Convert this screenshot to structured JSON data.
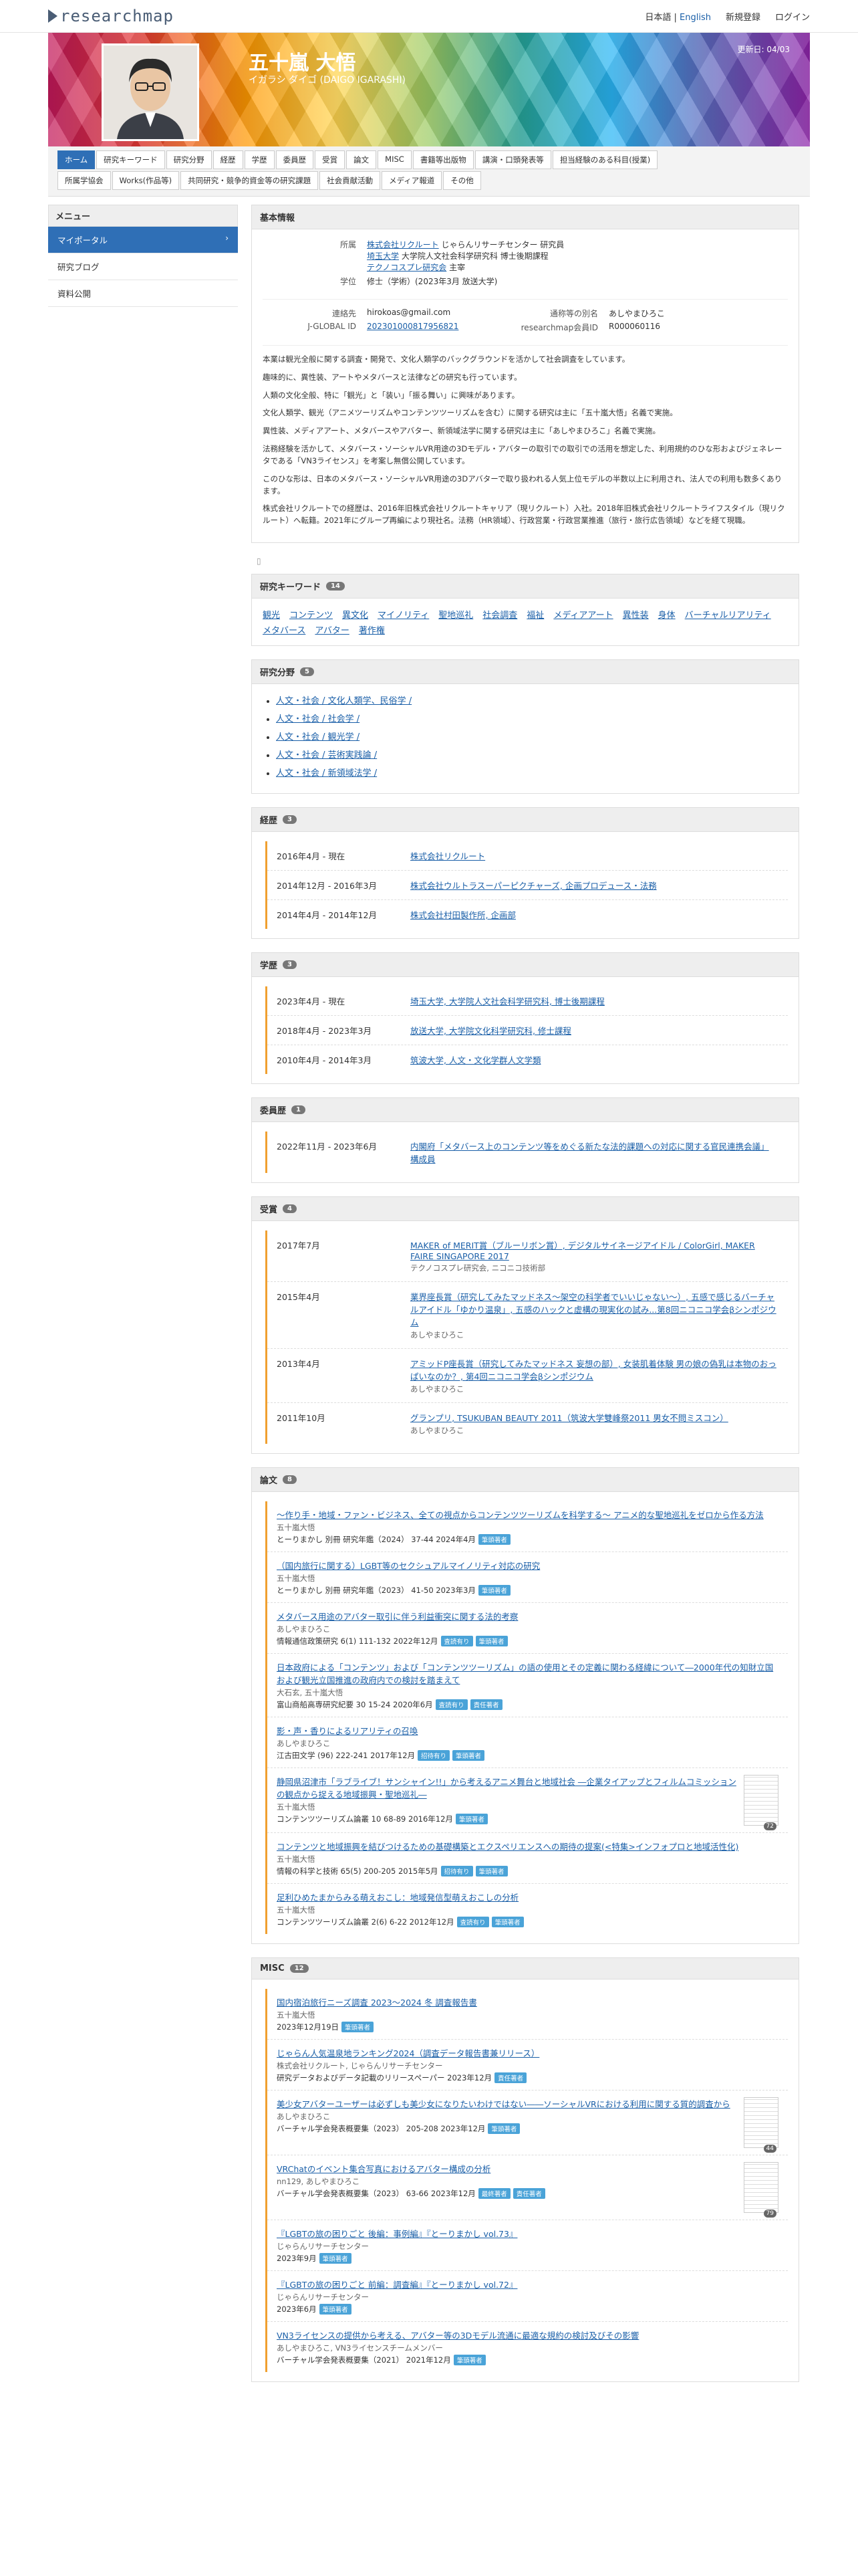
{
  "topbar": {
    "logo": "researchmap",
    "lang_ja": "日本語",
    "lang_sep": " | ",
    "lang_en": "English",
    "register": "新規登録",
    "login": "ログイン"
  },
  "hero": {
    "name": "五十嵐 大悟",
    "kana": "イガラシ ダイゴ (DAIGO IGARASHI)",
    "updated": "更新日: 04/03"
  },
  "tabs": {
    "row1": [
      "ホーム",
      "研究キーワード",
      "研究分野",
      "経歴",
      "学歴",
      "委員歴",
      "受賞",
      "論文",
      "MISC",
      "書籍等出版物",
      "講演・口頭発表等",
      "担当経験のある科目(授業)"
    ],
    "row2": [
      "所属学協会",
      "Works(作品等)",
      "共同研究・競争的資金等の研究課題",
      "社会貢献活動",
      "メディア報道",
      "その他"
    ]
  },
  "sidebar": {
    "head": "メニュー",
    "items": [
      "マイポータル",
      "研究ブログ",
      "資料公開"
    ]
  },
  "basic": {
    "title": "基本情報",
    "affil_label": "所属",
    "affil1_link": "株式会社リクルート",
    "affil1_rest": " じゃらんリサーチセンター 研究員",
    "affil2_link": "埼玉大学",
    "affil2_rest": " 大学院人文社会科学研究科 博士後期課程",
    "affil3_link": "テクノコスプレ研究会",
    "affil3_rest": " 主宰",
    "degree_label": "学位",
    "degree": "修士（学術）(2023年3月 放送大学)",
    "contact_label": "連絡先",
    "contact": "hirokoas@gmail.com",
    "alias_label": "通称等の別名",
    "alias": "あしやまひろこ",
    "jglobal_label": "J-GLOBAL ID",
    "jglobal": "202301000817956821",
    "rmid_label": "researchmap会員ID",
    "rmid": "R000060116",
    "bio": [
      "本業は観光全般に関する調査・開発で、文化人類学のバックグラウンドを活かして社会調査をしています。",
      "趣味的に、異性装、アートやメタバースと法律などの研究も行っています。",
      "人類の文化全般、特に「観光」と「装い」「振る舞い」に興味があります。",
      "文化人類学、観光（アニメツーリズムやコンテンツツーリズムを含む）に関する研究は主に「五十嵐大悟」名義で実施。",
      "異性装、メディアアート、メタバースやアバター、新領域法学に関する研究は主に「あしやまひろこ」名義で実施。",
      "法務経験を活かして、メタバース・ソーシャルVR用途の3Dモデル・アバターの取引での取引での活用を想定した、利用規約のひな形およびジェネレータである「VN3ライセンス」を考案し無償公開しています。",
      "このひな形は、日本のメタバース・ソーシャルVR用途の3Dアバターで取り扱われる人気上位モデルの半数以上に利用され、法人での利用も数多くあります。",
      "株式会社リクルートでの経歴は、2016年旧株式会社リクルートキャリア（現リクルート）入社。2018年旧株式会社リクルートライフスタイル（現リクルート）へ転籍。2021年にグループ再編により現社名。法務（HR領域）、行政営業・行政営業推進（旅行・旅行広告領域）などを経て現職。"
    ]
  },
  "keywords": {
    "title": "研究キーワード",
    "count": "14",
    "items": [
      "観光",
      "コンテンツ",
      "異文化",
      "マイノリティ",
      "聖地巡礼",
      "社会調査",
      "福祉",
      "メディアアート",
      "異性装",
      "身体",
      "バーチャルリアリティ",
      "メタバース",
      "アバター",
      "著作権"
    ]
  },
  "fields": {
    "title": "研究分野",
    "count": "5",
    "items": [
      "人文・社会 / 文化人類学、民俗学 /",
      "人文・社会 / 社会学 /",
      "人文・社会 / 観光学 /",
      "人文・社会 / 芸術実践論 /",
      "人文・社会 / 新領域法学 /"
    ]
  },
  "career": {
    "title": "経歴",
    "count": "3",
    "items": [
      {
        "date": "2016年4月 - 現在",
        "text": "株式会社リクルート"
      },
      {
        "date": "2014年12月 - 2016年3月",
        "text": "株式会社ウルトラスーパーピクチャーズ, 企画プロデュース・法務"
      },
      {
        "date": "2014年4月 - 2014年12月",
        "text": "株式会社村田製作所, 企画部"
      }
    ]
  },
  "education": {
    "title": "学歴",
    "count": "3",
    "items": [
      {
        "date": "2023年4月 - 現在",
        "text": "埼玉大学, 大学院人文社会科学研究科, 博士後期課程"
      },
      {
        "date": "2018年4月 - 2023年3月",
        "text": "放送大学, 大学院文化科学研究科, 修士課程"
      },
      {
        "date": "2010年4月 - 2014年3月",
        "text": "筑波大学, 人文・文化学群人文学類"
      }
    ]
  },
  "committee": {
    "title": "委員歴",
    "count": "1",
    "items": [
      {
        "date": "2022年11月 - 2023年6月",
        "text": "内閣府「メタバース上のコンテンツ等をめぐる新たな法的課題への対応に関する官民連携会議」 構成員"
      }
    ]
  },
  "awards": {
    "title": "受賞",
    "count": "4",
    "items": [
      {
        "date": "2017年7月",
        "text": "MAKER of MERIT賞（ブルーリボン賞）, デジタルサイネージアイドル / ColorGirl, MAKER FAIRE SINGAPORE 2017",
        "sub": "テクノコスプレ研究会, ニコニコ技術部"
      },
      {
        "date": "2015年4月",
        "text": "業界座長賞（研究してみたマッドネス〜架空の科学者でいいじゃない〜）, 五感で感じるバーチャルアイドル「ゆかり温泉」, 五感のハックと虚構の現実化の試み...第8回ニコニコ学会βシンポジウム",
        "sub": "あしやまひろこ"
      },
      {
        "date": "2013年4月",
        "text": "アミッドP座長賞（研究してみたマッドネス 妄想の部）, 女装肌着体験 男の娘の偽乳は本物のおっぱいなのか？, 第4回ニコニコ学会βシンポジウム",
        "sub": "あしやまひろこ"
      },
      {
        "date": "2011年10月",
        "text": "グランプリ, TSUKUBAN BEAUTY 2011（筑波大学雙峰祭2011 男女不問ミスコン）",
        "sub": "あしやまひろこ"
      }
    ]
  },
  "papers": {
    "title": "論文",
    "count": "8",
    "items": [
      {
        "title": "〜作り手・地域・ファン・ビジネス、全ての視点からコンテンツツーリズムを科学する〜 アニメ的な聖地巡礼をゼロから作る方法",
        "author": "五十嵐大悟",
        "meta": "とーりまかし 別冊 研究年鑑（2024） 37-44 2024年4月",
        "tags": [
          "筆頭著者"
        ],
        "thumb": ""
      },
      {
        "title": "（国内旅行に関する）LGBT等のセクシュアルマイノリティ対応の研究",
        "author": "五十嵐大悟",
        "meta": "とーりまかし 別冊 研究年鑑（2023） 41-50 2023年3月",
        "tags": [
          "筆頭著者"
        ],
        "thumb": ""
      },
      {
        "title": "メタバース用途のアバター取引に伴う利益衝突に関する法的考察",
        "author": "あしやまひろこ",
        "meta": "情報通信政策研究 6(1) 111-132 2022年12月",
        "tags": [
          "査読有り",
          "筆頭著者"
        ],
        "thumb": ""
      },
      {
        "title": "日本政府による「コンテンツ」および「コンテンツツーリズム」の語の使用とその定義に関わる経緯について―2000年代の知財立国および観光立国推進の政府内での検討を踏まえて",
        "author": "大石玄, 五十嵐大悟",
        "meta": "富山商船高専研究紀要 30 15-24 2020年6月",
        "tags": [
          "査読有り",
          "責任著者"
        ],
        "thumb": ""
      },
      {
        "title": "影・声・香りによるリアリティの召喚",
        "author": "あしやまひろこ",
        "meta": "江古田文学 (96) 222-241 2017年12月",
        "tags": [
          "招待有り",
          "筆頭著者"
        ],
        "thumb": ""
      },
      {
        "title": "静岡県沼津市「ラブライブ！サンシャイン!!」から考えるアニメ舞台と地域社会 ―企業タイアップとフィルムコミッションの観点から捉える地域振興・聖地巡礼―",
        "author": "五十嵐大悟",
        "meta": "コンテンツツーリズム論叢 10 68-89 2016年12月",
        "tags": [
          "筆頭著者"
        ],
        "thumb": "72"
      },
      {
        "title": "コンテンツと地域振興を結びつけるための基礎構築とエクスペリエンスへの期待の提案(<特集>インフォプロと地域活性化)",
        "author": "五十嵐大悟",
        "meta": "情報の科学と技術 65(5) 200-205 2015年5月",
        "tags": [
          "招待有り",
          "筆頭著者"
        ],
        "thumb": ""
      },
      {
        "title": "足利ひめたまからみる萌えおこし：地域発信型萌えおこしの分析",
        "author": "五十嵐大悟",
        "meta": "コンテンツツーリズム論叢 2(6) 6-22 2012年12月",
        "tags": [
          "査読有り",
          "筆頭著者"
        ],
        "thumb": ""
      }
    ]
  },
  "misc": {
    "title": "MISC",
    "count": "12",
    "items": [
      {
        "title": "国内宿泊旅行ニーズ調査 2023〜2024 冬 調査報告書",
        "author": "五十嵐大悟",
        "meta": "2023年12月19日",
        "tags": [
          "筆頭著者"
        ],
        "thumb": ""
      },
      {
        "title": "じゃらん人気温泉地ランキング2024（調査データ報告書兼リリース）",
        "author": "株式会社リクルート, じゃらんリサーチセンター",
        "meta": "研究データおよびデータ記載のリリースペーパー 2023年12月",
        "tags": [
          "責任著者"
        ],
        "thumb": ""
      },
      {
        "title": "美少女アバターユーザーは必ずしも美少女になりたいわけではない――ソーシャルVRにおける利用に関する質的調査から",
        "author": "あしやまひろこ",
        "meta": "バーチャル学会発表概要集（2023） 205-208 2023年12月",
        "tags": [
          "筆頭著者"
        ],
        "thumb": "44"
      },
      {
        "title": "VRChatのイベント集合写真におけるアバター構成の分析",
        "author": "nn129, あしやまひろこ",
        "meta": "バーチャル学会発表概要集（2023） 63-66 2023年12月",
        "tags": [
          "最終著者",
          "責任著者"
        ],
        "thumb": "79"
      },
      {
        "title": "『LGBTの旅の困りごと 後編：事例編』『とーりまかし vol.73』",
        "author": "じゃらんリサーチセンター",
        "meta": "2023年9月",
        "tags": [
          "筆頭著者"
        ],
        "thumb": ""
      },
      {
        "title": "『LGBTの旅の困りごと 前編：調査編』『とーりまかし vol.72』",
        "author": "じゃらんリサーチセンター",
        "meta": "2023年6月",
        "tags": [
          "筆頭著者"
        ],
        "thumb": ""
      },
      {
        "title": "VN3ライセンスの提供から考える、アバター等の3Dモデル流通に最適な規約の検討及びその影響",
        "author": "あしやまひろこ, VN3ライセンスチームメンバー",
        "meta": "バーチャル学会発表概要集（2021） 2021年12月",
        "tags": [
          "筆頭著者"
        ],
        "thumb": ""
      }
    ]
  }
}
